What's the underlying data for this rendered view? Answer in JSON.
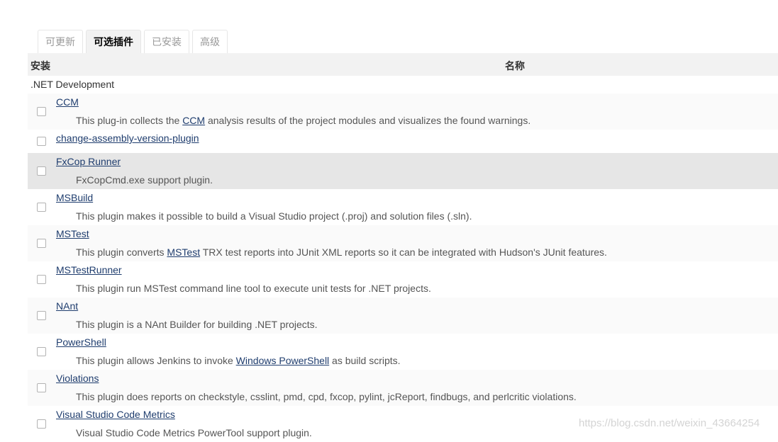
{
  "tabs": [
    {
      "label": "可更新"
    },
    {
      "label": "可选插件"
    },
    {
      "label": "已安装"
    },
    {
      "label": "高级"
    }
  ],
  "table": {
    "col_install": "安装",
    "col_name": "名称"
  },
  "category": ".NET Development",
  "plugins": [
    {
      "name": "CCM",
      "desc_pre": "This plug-in collects the ",
      "desc_link": "CCM",
      "desc_post": " analysis results of the project modules and visualizes the found warnings."
    },
    {
      "name": "change-assembly-version-plugin"
    },
    {
      "name": "FxCop Runner",
      "desc_pre": "FxCopCmd.exe support plugin."
    },
    {
      "name": "MSBuild",
      "desc_pre": "This plugin makes it possible to build a Visual Studio project (.proj) and solution files (.sln)."
    },
    {
      "name": "MSTest",
      "desc_pre": "This plugin converts ",
      "desc_link": "MSTest",
      "desc_post": " TRX test reports into JUnit XML reports so it can be integrated with Hudson's JUnit features."
    },
    {
      "name": "MSTestRunner",
      "desc_pre": "This plugin run MSTest command line tool to execute unit tests for .NET projects."
    },
    {
      "name": "NAnt",
      "desc_pre": "This plugin is a NAnt Builder for building .NET projects."
    },
    {
      "name": "PowerShell",
      "desc_pre": "This plugin allows Jenkins to invoke ",
      "desc_link": "Windows PowerShell",
      "desc_post": " as build scripts."
    },
    {
      "name": "Violations",
      "desc_pre": "This plugin does reports on checkstyle, csslint, pmd, cpd, fxcop, pylint, jcReport, findbugs, and perlcritic violations."
    },
    {
      "name": "Visual Studio Code Metrics",
      "desc_pre": "Visual Studio Code Metrics PowerTool support plugin."
    }
  ],
  "watermark": "https://blog.csdn.net/weixin_43664254"
}
